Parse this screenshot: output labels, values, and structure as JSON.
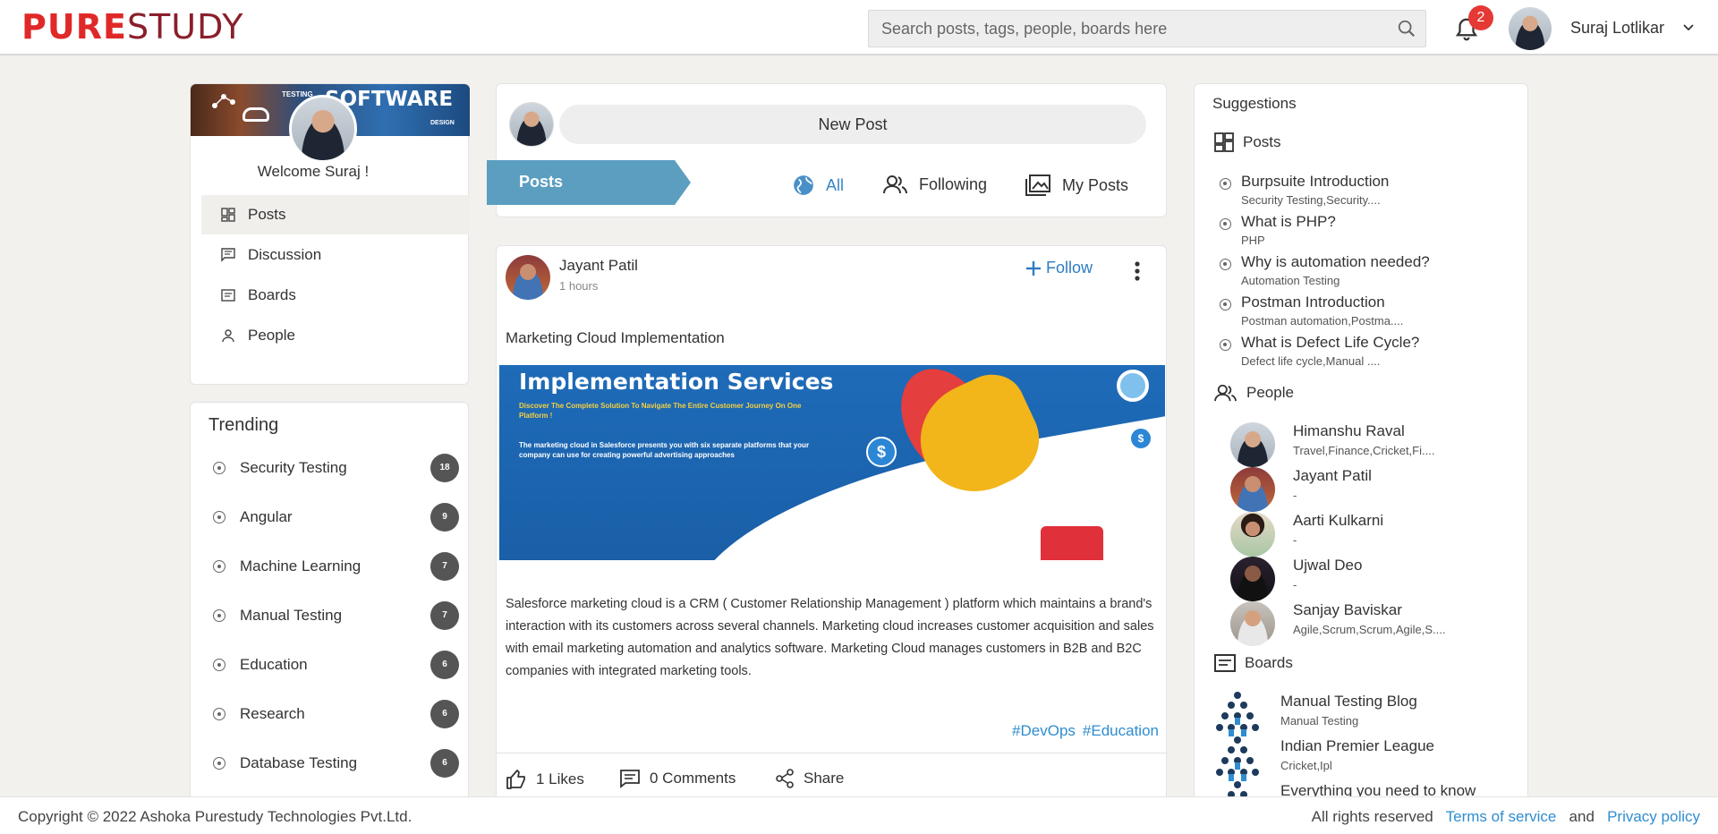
{
  "header": {
    "logo_part1": "PURE",
    "logo_part2": "STUDY",
    "search_placeholder": "Search posts, tags, people, boards here",
    "notification_count": "2",
    "user_name": "Suraj Lotlikar"
  },
  "profile": {
    "banner_big": "SOFTWARE",
    "banner_small": "TESTING",
    "banner_design": "DESIGN",
    "welcome": "Welcome Suraj !"
  },
  "nav": [
    {
      "label": "Posts"
    },
    {
      "label": "Discussion"
    },
    {
      "label": "Boards"
    },
    {
      "label": "People"
    }
  ],
  "trending": {
    "title": "Trending",
    "items": [
      {
        "label": "Security Testing",
        "count": "18"
      },
      {
        "label": "Angular",
        "count": "9"
      },
      {
        "label": "Machine Learning",
        "count": "7"
      },
      {
        "label": "Manual Testing",
        "count": "7"
      },
      {
        "label": "Education",
        "count": "6"
      },
      {
        "label": "Research",
        "count": "6"
      },
      {
        "label": "Database Testing",
        "count": "6"
      }
    ]
  },
  "composer": {
    "new_post": "New Post",
    "posts_tab": "Posts",
    "filters": {
      "all": "All",
      "following": "Following",
      "my_posts": "My Posts"
    }
  },
  "post": {
    "author": "Jayant Patil",
    "time": "1 hours",
    "follow": "Follow",
    "title": "Marketing Cloud Implementation",
    "image_heading": "Implementation Services",
    "image_sub": "Discover The Complete Solution To Navigate The Entire Customer Journey On One Platform !",
    "image_desc": "The marketing cloud in Salesforce presents you with six separate platforms that your company can use for creating powerful advertising approaches",
    "body": "Salesforce marketing cloud is a CRM ( Customer Relationship Management ) platform which maintains a brand's interaction with its customers across several channels. Marketing cloud increases customer acquisition and sales with email marketing automation and analytics software. Marketing Cloud manages customers in B2B and B2C companies with integrated marketing tools.",
    "tags": [
      "#DevOps",
      "#Education"
    ],
    "likes": "1 Likes",
    "comments": "0 Comments",
    "share": "Share"
  },
  "suggestions": {
    "title": "Suggestions",
    "posts_head": "Posts",
    "posts": [
      {
        "title": "Burpsuite Introduction",
        "sub": "Security Testing,Security...."
      },
      {
        "title": "What is PHP?",
        "sub": "PHP"
      },
      {
        "title": "Why is automation needed?",
        "sub": "Automation Testing"
      },
      {
        "title": "Postman Introduction",
        "sub": "Postman automation,Postma...."
      },
      {
        "title": "What is Defect Life Cycle?",
        "sub": "Defect life cycle,Manual ...."
      }
    ],
    "people_head": "People",
    "people": [
      {
        "name": "Himanshu Raval",
        "sub": "Travel,Finance,Cricket,Fi...."
      },
      {
        "name": "Jayant Patil",
        "sub": "-"
      },
      {
        "name": "Aarti Kulkarni",
        "sub": "-"
      },
      {
        "name": "Ujwal Deo",
        "sub": "-"
      },
      {
        "name": "Sanjay Baviskar",
        "sub": "Agile,Scrum,Scrum,Agile,S...."
      }
    ],
    "boards_head": "Boards",
    "boards": [
      {
        "name": "Manual Testing Blog",
        "sub": "Manual Testing"
      },
      {
        "name": "Indian Premier League",
        "sub": "Cricket,Ipl"
      },
      {
        "name": "Everything you need to know",
        "sub": ""
      }
    ]
  },
  "footer": {
    "copyright": "Copyright © 2022 Ashoka Purestudy Technologies Pvt.Ltd.",
    "rights": "All rights reserved",
    "terms": "Terms of service",
    "and": "and",
    "privacy": "Privacy policy"
  },
  "colors": {
    "accent": "#2f8dd0",
    "posts_tab": "#5b9ec0",
    "logo_red": "#e02828",
    "badge_red": "#e53935"
  }
}
